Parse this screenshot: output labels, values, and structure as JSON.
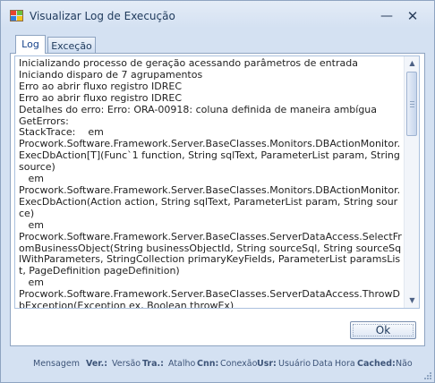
{
  "window": {
    "title": "Visualizar Log de Execução",
    "minimize_glyph": "—",
    "close_glyph": "✕",
    "app_icon": "app-windows-icon"
  },
  "tabs": [
    {
      "label": "Log",
      "selected": true
    },
    {
      "label": "Exceção",
      "selected": false
    }
  ],
  "log_text": "Inicializando processo de geração acessando parâmetros de entrada\nIniciando disparo de 7 agrupamentos\nErro ao abrir fluxo registro IDREC\nErro ao abrir fluxo registro IDREC\nDetalhes do erro: Erro: ORA-00918: coluna definida de maneira ambígua\nGetErrors:\nStackTrace:    em\nProcwork.Software.Framework.Server.BaseClasses.Monitors.DBActionMonitor.ExecDbAction[T](Func`1 function, String sqlText, ParameterList param, String source)\n   em\nProcwork.Software.Framework.Server.BaseClasses.Monitors.DBActionMonitor.ExecDbAction(Action action, String sqlText, ParameterList param, String source)\n   em\nProcwork.Software.Framework.Server.BaseClasses.ServerDataAccess.SelectFromBusinessObject(String businessObjectId, String sourceSql, String sourceSqlWithParameters, StringCollection primaryKeyFields, ParameterList paramsList, PageDefinition pageDefinition)\n   em\nProcwork.Software.Framework.Server.BaseClasses.ServerDataAccess.ThrowDbException(Exception ex, Boolean throwEx)\n   em\nProcwork.Software.Framework.Server.BaseClasses.ServerDataAccess.SelectFromBusin",
  "scrollbar": {
    "up_glyph": "▲",
    "down_glyph": "▼"
  },
  "ok_button": {
    "label": "Ok"
  },
  "status": {
    "mensagem": "Mensagem",
    "ver_key": "Ver.:",
    "ver_val": "Versão",
    "tra_key": "Tra.:",
    "tra_val": "Atalho",
    "cnn_key": "Cnn:",
    "cnn_val": "Conexão",
    "usr_key": "Usr:",
    "usr_val": "Usuário",
    "data": "Data",
    "hora": "Hora",
    "cached_key": "Cached:",
    "cached_val": "Não"
  }
}
